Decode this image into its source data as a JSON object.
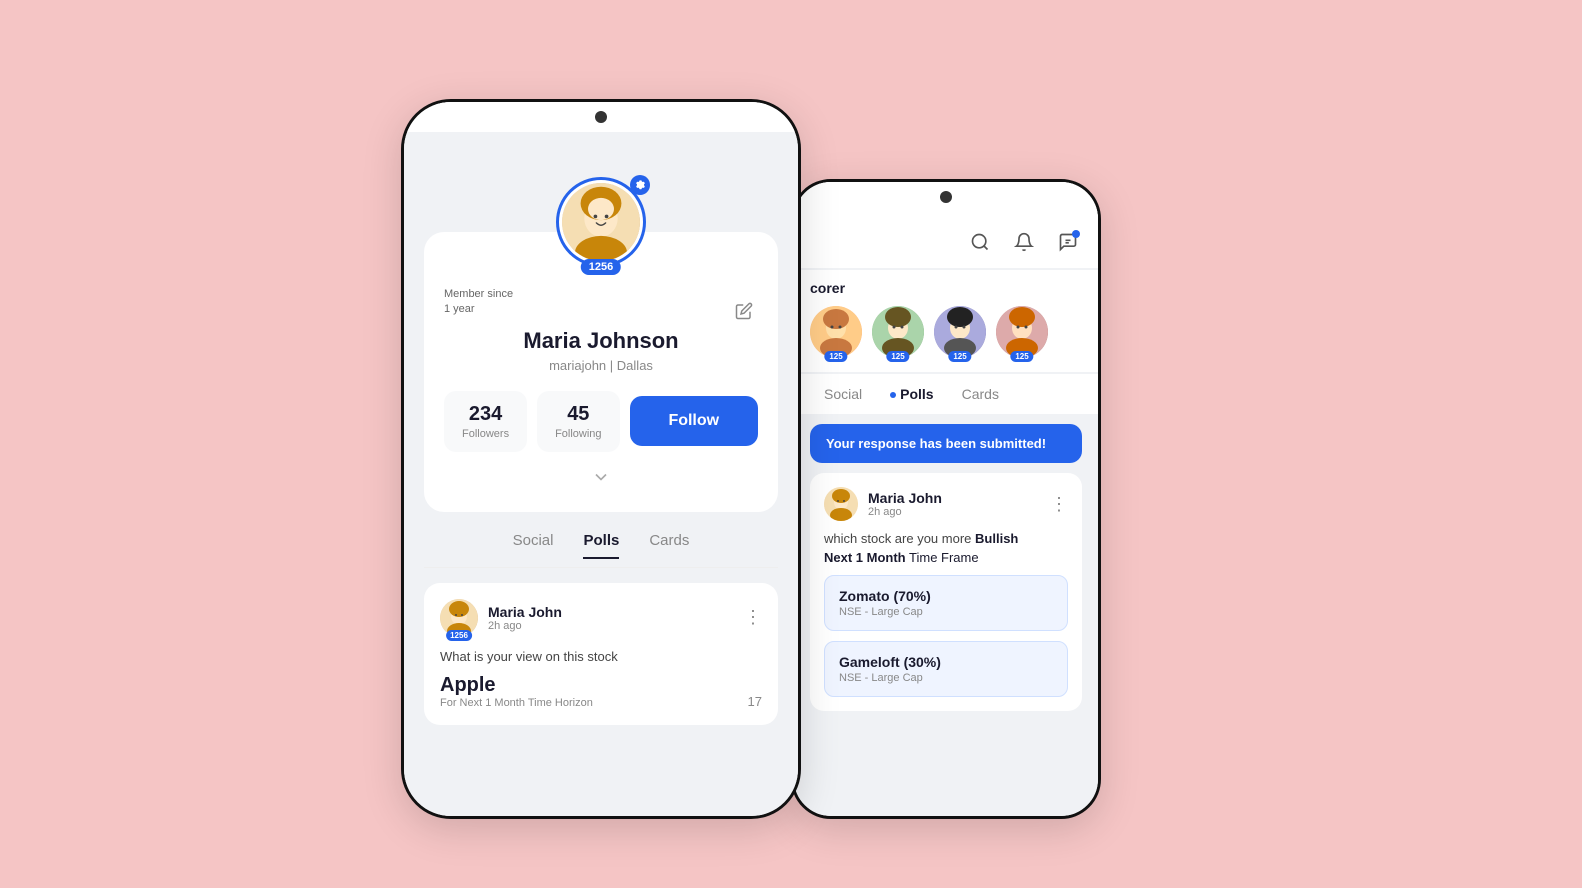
{
  "background": "#f5c5c5",
  "phone_left": {
    "avatar_score": "1256",
    "member_since": "Member since",
    "member_duration": "1 year",
    "profile_name": "Maria Johnson",
    "profile_handle": "mariajohn",
    "profile_location": "Dallas",
    "followers_count": "234",
    "followers_label": "Followers",
    "following_count": "45",
    "following_label": "Following",
    "follow_button": "Follow",
    "tabs": [
      "Social",
      "Polls",
      "Cards"
    ],
    "active_tab": "Polls",
    "post": {
      "username": "Maria John",
      "time": "2h ago",
      "question": "What is your view on this stock",
      "stock_name": "Apple",
      "stock_sub": "For Next 1 Month Time Horizon",
      "vote_count": "17"
    }
  },
  "phone_right": {
    "header_icons": [
      "search",
      "bell",
      "chat"
    ],
    "scorer_title": "corer",
    "scorer_users": [
      {
        "score": "125"
      },
      {
        "score": "125"
      },
      {
        "score": "125"
      },
      {
        "score": "125"
      }
    ],
    "tabs": [
      "Social",
      "Polls",
      "Cards"
    ],
    "active_tab": "Polls",
    "response_banner": "Your response has been submitted!",
    "post": {
      "username": "Maria John",
      "time": "2h ago",
      "question_prefix": "which stock are you more",
      "question_bold": "Bullish",
      "timeframe_prefix": "Next 1 Month",
      "timeframe_suffix": "Time Frame",
      "options": [
        {
          "label": "Zomato (70%)",
          "sub": "NSE - Large Cap"
        },
        {
          "label": "Gameloft (30%)",
          "sub": "NSE - Large Cap"
        }
      ]
    }
  }
}
